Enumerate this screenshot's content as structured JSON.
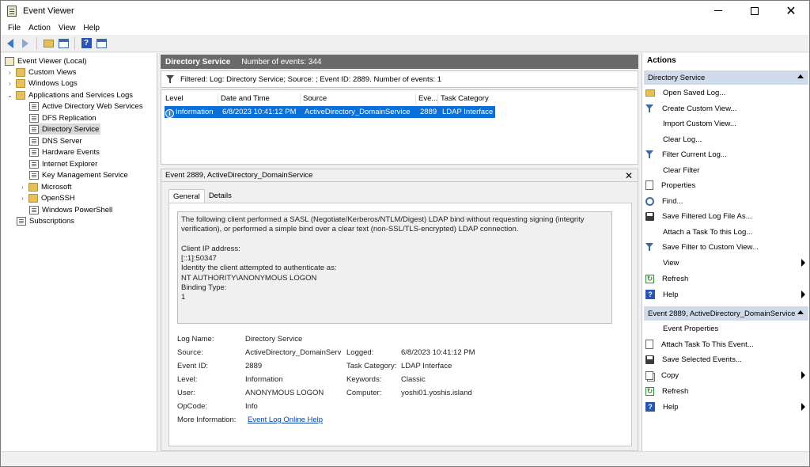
{
  "window": {
    "title": "Event Viewer"
  },
  "menu": [
    "File",
    "Action",
    "View",
    "Help"
  ],
  "tree": {
    "root": "Event Viewer (Local)",
    "custom_views": "Custom Views",
    "windows_logs": "Windows Logs",
    "apps_services": "Applications and Services Logs",
    "children": [
      "Active Directory Web Services",
      "DFS Replication",
      "Directory Service",
      "DNS Server",
      "Hardware Events",
      "Internet Explorer",
      "Key Management Service",
      "Microsoft",
      "OpenSSH",
      "Windows PowerShell"
    ],
    "subscriptions": "Subscriptions"
  },
  "header": {
    "log_name": "Directory Service",
    "count_text": "Number of events: 344"
  },
  "filter": {
    "text": "Filtered: Log: Directory Service; Source: ; Event ID: 2889. Number of events: 1"
  },
  "grid": {
    "columns": [
      "Level",
      "Date and Time",
      "Source",
      "Eve...",
      "Task Category"
    ],
    "row": {
      "level": "Information",
      "datetime": "6/8/2023 10:41:12 PM",
      "source": "ActiveDirectory_DomainService",
      "event_id": "2889",
      "category": "LDAP Interface"
    }
  },
  "detail": {
    "title": "Event 2889, ActiveDirectory_DomainService",
    "tabs": [
      "General",
      "Details"
    ],
    "description": "The following client performed a SASL (Negotiate/Kerberos/NTLM/Digest) LDAP bind without requesting signing (integrity verification), or performed a simple bind over a clear text (non-SSL/TLS-encrypted) LDAP connection.\n\nClient IP address:\n[::1]:50347\nIdentity the client attempted to authenticate as:\nNT AUTHORITY\\ANONYMOUS LOGON\nBinding Type:\n1",
    "labels": {
      "log_name": "Log Name:",
      "source": "Source:",
      "event_id": "Event ID:",
      "level": "Level:",
      "user": "User:",
      "opcode": "OpCode:",
      "more_info": "More Information:",
      "logged": "Logged:",
      "task_category": "Task Category:",
      "keywords": "Keywords:",
      "computer": "Computer:"
    },
    "values": {
      "log_name": "Directory Service",
      "source": "ActiveDirectory_DomainServi",
      "event_id": "2889",
      "level": "Information",
      "user": "ANONYMOUS LOGON",
      "opcode": "Info",
      "more_info_link": "Event Log Online Help",
      "logged": "6/8/2023 10:41:12 PM",
      "task_category": "LDAP Interface",
      "keywords": "Classic",
      "computer": "yoshi01.yoshis.island"
    }
  },
  "actions": {
    "title": "Actions",
    "section1": "Directory Service",
    "items1": [
      "Open Saved Log...",
      "Create Custom View...",
      "Import Custom View...",
      "Clear Log...",
      "Filter Current Log...",
      "Clear Filter",
      "Properties",
      "Find...",
      "Save Filtered Log File As...",
      "Attach a Task To this Log...",
      "Save Filter to Custom View...",
      "View",
      "Refresh",
      "Help"
    ],
    "section2": "Event 2889, ActiveDirectory_DomainService",
    "items2": [
      "Event Properties",
      "Attach Task To This Event...",
      "Save Selected Events...",
      "Copy",
      "Refresh",
      "Help"
    ]
  }
}
